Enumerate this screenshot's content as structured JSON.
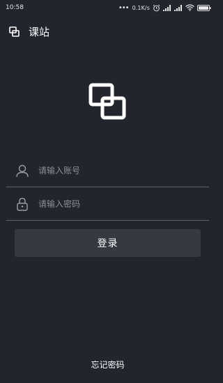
{
  "status_bar": {
    "time": "10:58",
    "network_speed": "0.1K/s",
    "icons": [
      "more-dots-icon",
      "alarm-icon",
      "signal-icon",
      "signal-icon",
      "wifi-icon",
      "battery-icon"
    ]
  },
  "app_bar": {
    "logo_icon": "overlapping-squares-icon",
    "title": "课站"
  },
  "logo": {
    "icon": "overlapping-squares-icon"
  },
  "form": {
    "account": {
      "icon": "user-icon",
      "placeholder": "请输入账号",
      "value": ""
    },
    "password": {
      "icon": "lock-icon",
      "placeholder": "请输入密码",
      "value": ""
    },
    "login_label": "登录",
    "forgot_label": "忘记密码"
  },
  "colors": {
    "background": "#22252d",
    "button_bg": "#363941",
    "divider": "#5d616a",
    "placeholder": "#8b8f97",
    "text": "#ffffff"
  }
}
